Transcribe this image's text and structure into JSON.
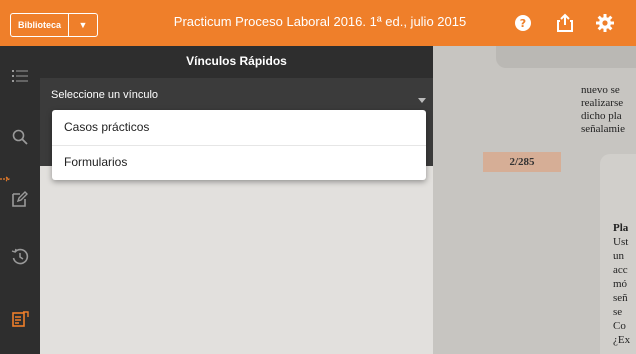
{
  "topbar": {
    "library_label": "Biblioteca",
    "title": "Practicum Proceso Laboral 2016. 1ª ed., julio 2015",
    "icons": [
      "chevron-down-icon",
      "help-icon",
      "share-icon",
      "gear-icon"
    ],
    "accent_color": "#ef7f2a"
  },
  "rail": {
    "icons": [
      "list-icon",
      "search-icon",
      "annotate-icon",
      "history-icon",
      "quick-links-icon"
    ],
    "active_icon_color": "#ef7f2a"
  },
  "panel": {
    "title": "Vínculos Rápidos",
    "select_label": "Seleccione un vínculo",
    "options": [
      "Casos prácticos",
      "Formularios"
    ]
  },
  "document": {
    "lines": [
      "nuevo se",
      "realizarse",
      "dicho pla",
      "señalamie"
    ],
    "page_indicator": "2/285",
    "box_heading": "Pla",
    "box_lines": [
      "Ust",
      "un",
      "acc",
      "mó",
      "señ",
      "se",
      "Co",
      "¿Ex"
    ]
  }
}
